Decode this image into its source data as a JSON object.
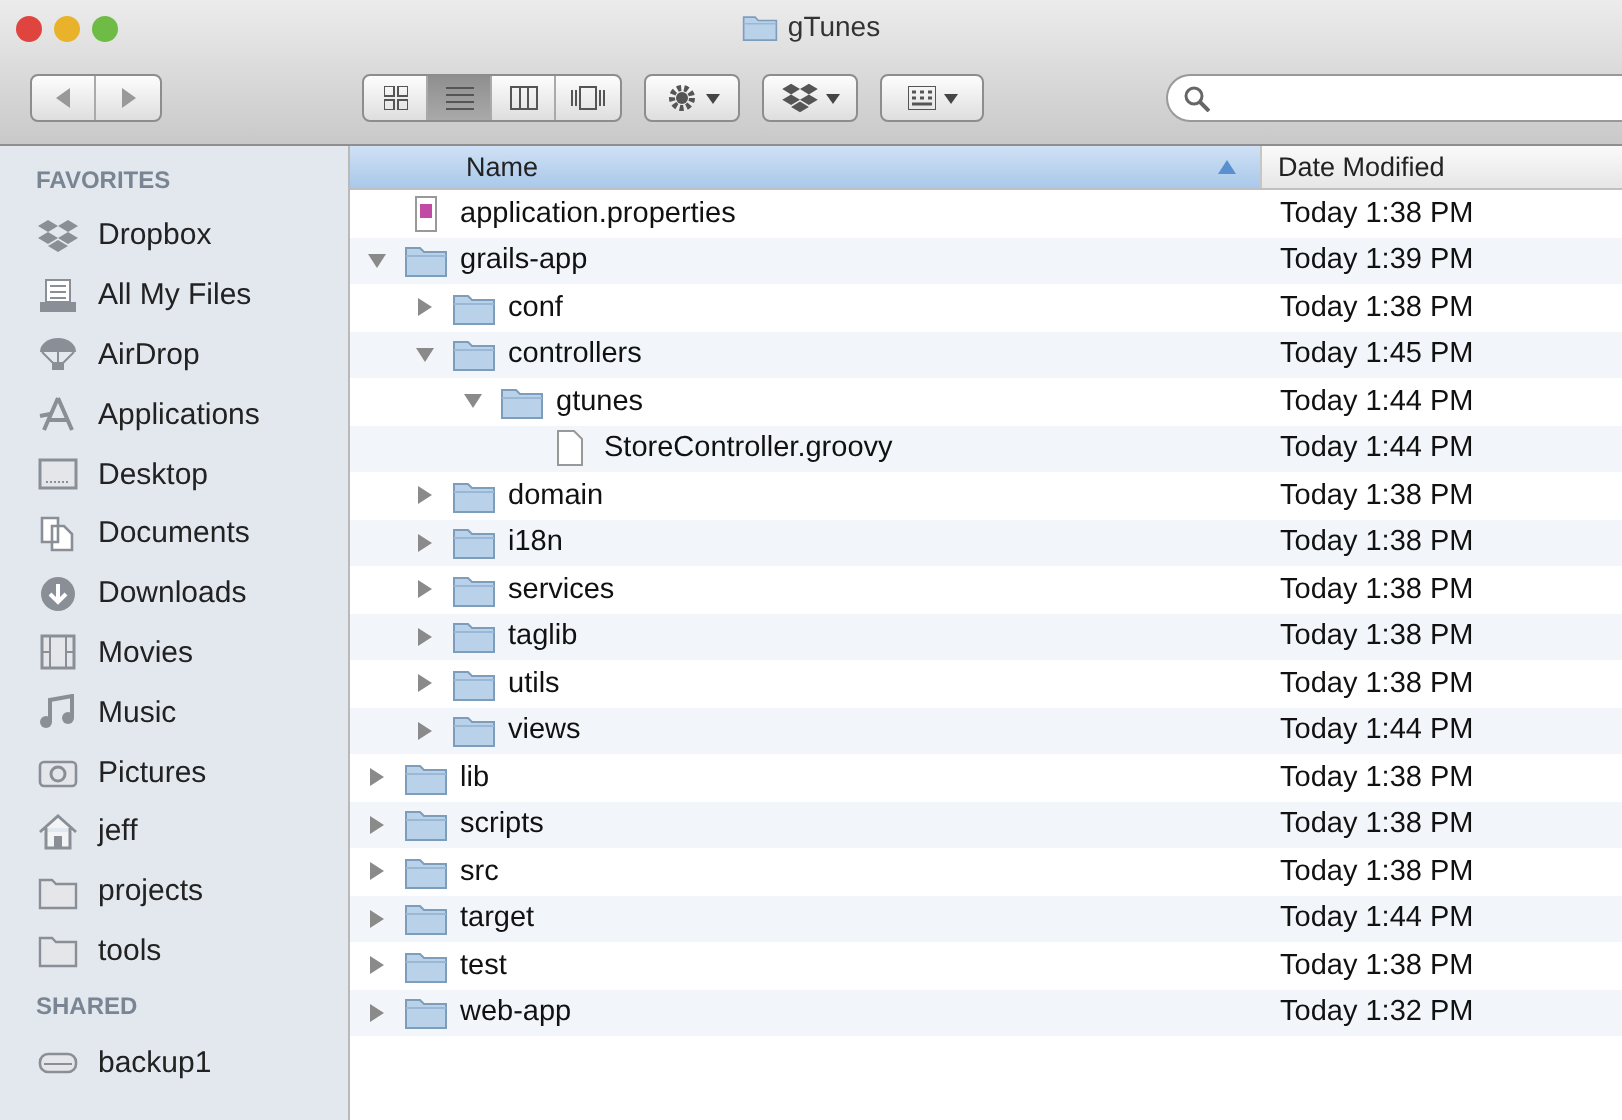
{
  "window": {
    "title": "gTunes"
  },
  "view_modes": [
    {
      "kind": "icons",
      "selected": false
    },
    {
      "kind": "list",
      "selected": true
    },
    {
      "kind": "columns",
      "selected": false
    },
    {
      "kind": "coverflow",
      "selected": false
    }
  ],
  "sidebar": {
    "sections": [
      {
        "title": "FAVORITES",
        "items": [
          {
            "label": "Dropbox",
            "kind": "dropbox"
          },
          {
            "label": "All My Files",
            "kind": "allfiles"
          },
          {
            "label": "AirDrop",
            "kind": "airdrop"
          },
          {
            "label": "Applications",
            "kind": "apps"
          },
          {
            "label": "Desktop",
            "kind": "desktop"
          },
          {
            "label": "Documents",
            "kind": "documents"
          },
          {
            "label": "Downloads",
            "kind": "downloads"
          },
          {
            "label": "Movies",
            "kind": "movies"
          },
          {
            "label": "Music",
            "kind": "music"
          },
          {
            "label": "Pictures",
            "kind": "pictures"
          },
          {
            "label": "jeff",
            "kind": "home"
          },
          {
            "label": "projects",
            "kind": "folder"
          },
          {
            "label": "tools",
            "kind": "folder"
          }
        ]
      },
      {
        "title": "SHARED",
        "items": [
          {
            "label": "backup1",
            "kind": "drive"
          }
        ]
      }
    ]
  },
  "table": {
    "columns": [
      {
        "label": "Name",
        "selected": true
      },
      {
        "label": "Date Modified",
        "selected": false
      }
    ],
    "rows": [
      {
        "name": "application.properties",
        "date": "Today 1:38 PM",
        "kind": "properties"
      },
      {
        "name": "grails-app",
        "date": "Today 1:39 PM",
        "kind": "folder",
        "expanded": true,
        "children": [
          {
            "name": "conf",
            "date": "Today 1:38 PM",
            "kind": "folder",
            "expanded": false
          },
          {
            "name": "controllers",
            "date": "Today 1:45 PM",
            "kind": "folder",
            "expanded": true,
            "children": [
              {
                "name": "gtunes",
                "date": "Today 1:44 PM",
                "kind": "folder",
                "expanded": true,
                "children": [
                  {
                    "name": "StoreController.groovy",
                    "date": "Today 1:44 PM",
                    "kind": "file"
                  }
                ]
              }
            ]
          },
          {
            "name": "domain",
            "date": "Today 1:38 PM",
            "kind": "folder",
            "expanded": false
          },
          {
            "name": "i18n",
            "date": "Today 1:38 PM",
            "kind": "folder",
            "expanded": false
          },
          {
            "name": "services",
            "date": "Today 1:38 PM",
            "kind": "folder",
            "expanded": false
          },
          {
            "name": "taglib",
            "date": "Today 1:38 PM",
            "kind": "folder",
            "expanded": false
          },
          {
            "name": "utils",
            "date": "Today 1:38 PM",
            "kind": "folder",
            "expanded": false
          },
          {
            "name": "views",
            "date": "Today 1:44 PM",
            "kind": "folder",
            "expanded": false
          }
        ]
      },
      {
        "name": "lib",
        "date": "Today 1:38 PM",
        "kind": "folder",
        "expanded": false
      },
      {
        "name": "scripts",
        "date": "Today 1:38 PM",
        "kind": "folder",
        "expanded": false
      },
      {
        "name": "src",
        "date": "Today 1:38 PM",
        "kind": "folder",
        "expanded": false
      },
      {
        "name": "target",
        "date": "Today 1:44 PM",
        "kind": "folder",
        "expanded": false
      },
      {
        "name": "test",
        "date": "Today 1:38 PM",
        "kind": "folder",
        "expanded": false
      },
      {
        "name": "web-app",
        "date": "Today 1:32 PM",
        "kind": "folder",
        "expanded": false
      }
    ]
  }
}
